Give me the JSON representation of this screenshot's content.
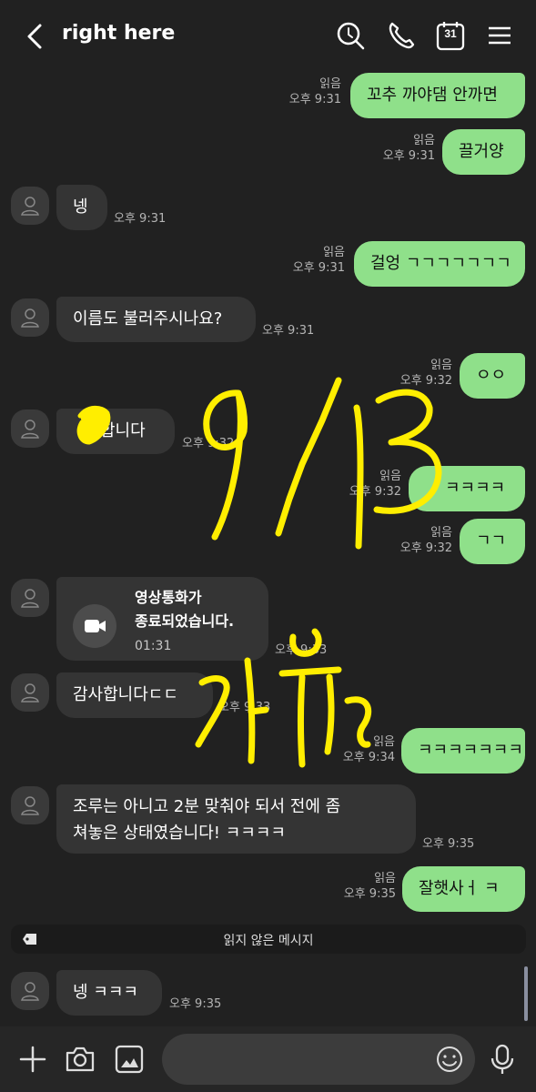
{
  "header": {
    "title": "right here"
  },
  "read_label": "읽음",
  "messages": [
    {
      "text": "꼬추 까야댐 안까면",
      "time": "오후 9:31"
    },
    {
      "text": "끌거양",
      "time": "오후 9:31"
    },
    {
      "text": "넹",
      "time": "오후 9:31"
    },
    {
      "text": "걸엉 ㄱㄱㄱㄱㄱㄱㄱ",
      "time": "오후 9:31"
    },
    {
      "text": "이름도 불러주시나요?",
      "time": "오후 9:31"
    },
    {
      "text": "ㅇㅇ",
      "time": "오후 9:32"
    },
    {
      "text": "합니다",
      "time": "오후 9:32"
    },
    {
      "text": "ㅋㅋㅋㅋ",
      "time": "오후 9:32"
    },
    {
      "text": "ㄱㄱ",
      "time": "오후 9:32"
    },
    {
      "text": "감사합니다ㄷㄷ",
      "time": "오후 9:33"
    },
    {
      "text": "ㅋㅋㅋㅋㅋㅋㅋ",
      "time": "오후 9:34"
    },
    {
      "text": "조루는 아니고 2분 맞춰야 되서 전에 좀",
      "text2": "쳐놓은 상태였습니다! ㅋㅋㅋㅋ",
      "time": "오후 9:35"
    },
    {
      "text": "잘햇사ㅓ ㅋ",
      "time": "오후 9:35"
    },
    {
      "text": "넹 ㅋㅋㅋ",
      "time": "오후 9:35"
    }
  ],
  "video_call": {
    "line1": "영상통화가",
    "line2": "종료되었습니다.",
    "duration": "01:31",
    "time": "오후 9:33"
  },
  "unread_divider": "읽지 않은 메시지",
  "annotations": {
    "date": "9/13",
    "word": "리뷰",
    "color": "#ffee00"
  },
  "colors": {
    "background": "#212121",
    "outgoing_bubble": "#8fe08a",
    "incoming_bubble": "#343434"
  }
}
